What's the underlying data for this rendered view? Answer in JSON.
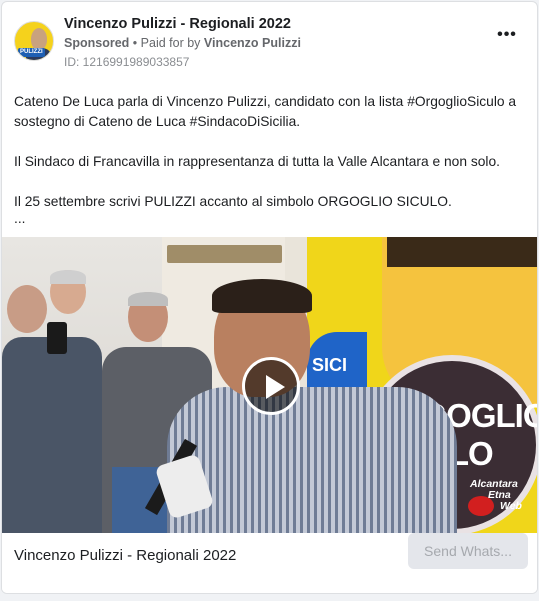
{
  "post": {
    "page_name": "Vincenzo Pulizzi - Regionali 2022",
    "sponsored_label": "Sponsored",
    "separator": "•",
    "paid_for_prefix": "Paid for by",
    "paid_for_name": "Vincenzo Pulizzi",
    "id_text": "ID: 1216991989033857",
    "more_icon": "more-horizontal-icon",
    "avatar_tag": "PULIZZI",
    "text_paragraphs": [
      "Cateno De Luca parla di Vincenzo Pulizzi, candidato con la lista #OrgoglioSiculo a sostegno di Cateno de Luca #SindacoDiSicilia.",
      "Il Sindaco di Francavilla in rappresentanza di tutta la Valle Alcantara e non solo.",
      "Il 25 settembre scrivi PULIZZI accanto al simbolo ORGOGLIO SICULO."
    ],
    "text_ellipsis": "..."
  },
  "media": {
    "poster_text_line1": "ORGOGLIO",
    "poster_text_line2": "SICULO",
    "poster_side_text": "SICI",
    "watermark_line1": "Alcantara",
    "watermark_line2": "Etna",
    "watermark_line3": "Web",
    "play_icon": "play-icon"
  },
  "footer": {
    "title": "Vincenzo Pulizzi - Regionali 2022",
    "cta_label": "Send Whats..."
  }
}
